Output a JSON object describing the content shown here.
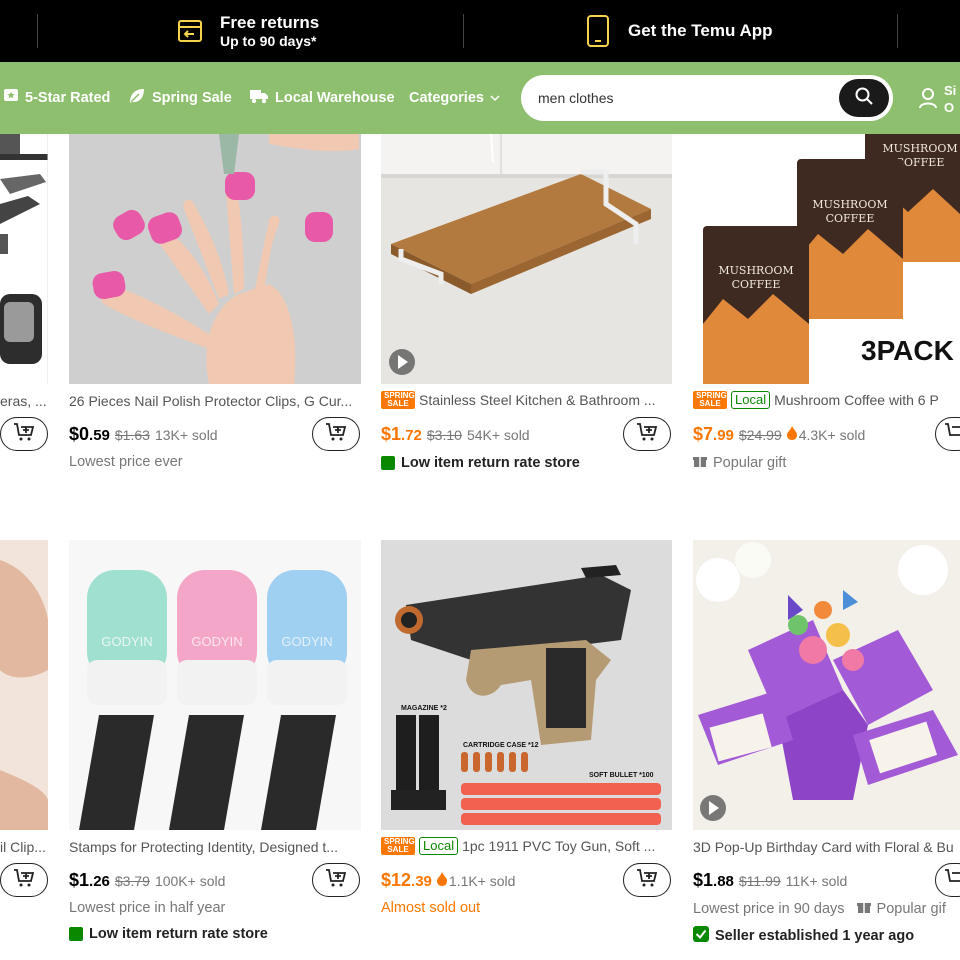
{
  "promo_bar": {
    "returns_title": "Free returns",
    "returns_sub": "Up to 90 days*",
    "app_label": "Get the Temu App"
  },
  "nav": {
    "items": [
      {
        "label": "5-Star Rated",
        "icon": "star-badge-icon"
      },
      {
        "label": "Spring Sale",
        "icon": "leaf-icon"
      },
      {
        "label": "Local Warehouse",
        "icon": "truck-icon"
      },
      {
        "label": "Categories",
        "icon": "chevron-down-icon"
      }
    ],
    "search_value": "men clothes",
    "signin_line1": "Si",
    "signin_line2": "O"
  },
  "colors": {
    "nav_green": "#8ebf6e",
    "accent_orange": "#fb7701",
    "trust_green": "#0a8800"
  },
  "products_row1": [
    {
      "title": "eras, ...",
      "price_dollars": "",
      "price_cents": "",
      "sub": ""
    },
    {
      "title": "26 Pieces Nail Polish Protector Clips, G Cur...",
      "price_dollars": "$0",
      "price_cents": ".59",
      "old_price": "$1.63",
      "sold": "13K+ sold",
      "sub": "Lowest price ever"
    },
    {
      "badge": "SPRING SALE",
      "title": "Stainless Steel Kitchen & Bathroom ...",
      "price_dollars": "$1",
      "price_cents": ".72",
      "old_price": "$3.10",
      "sold": "54K+ sold",
      "sub": "Low item return rate store"
    },
    {
      "badge": "SPRING SALE",
      "local": "Local",
      "title": "Mushroom Coffee with 6 P",
      "price_dollars": "$7",
      "price_cents": ".99",
      "old_price": "$24.99",
      "sold": "4.3K+ sold",
      "sub": "Popular gift",
      "img_text_1": "MUSHROOM",
      "img_text_2": "COFFEE",
      "img_text_3": "3PACK"
    }
  ],
  "products_row2": [
    {
      "title": "il Clip..."
    },
    {
      "title": "Stamps for Protecting Identity, Designed t...",
      "price_dollars": "$1",
      "price_cents": ".26",
      "old_price": "$3.79",
      "sold": "100K+ sold",
      "sub": "Lowest price in half year",
      "sub2": "Low item return rate store",
      "img_brand": "GODYIN"
    },
    {
      "badge": "SPRING SALE",
      "local": "Local",
      "title": "1pc 1911 PVC Toy Gun, Soft ...",
      "price_dollars": "$12",
      "price_cents": ".39",
      "sold": "1.1K+ sold",
      "sub": "Almost sold out",
      "img_text_1": "MAGAZINE *2",
      "img_text_2": "CARTRIDGE CASE *12",
      "img_text_3": "SOFT BULLET *100"
    },
    {
      "title": "3D Pop-Up Birthday Card with Floral & Bu",
      "price_dollars": "$1",
      "price_cents": ".88",
      "old_price": "$11.99",
      "sold": "11K+ sold",
      "sub": "Lowest price in 90 days",
      "sub_b": "Popular gif",
      "sub2": "Seller established 1 year ago"
    }
  ]
}
